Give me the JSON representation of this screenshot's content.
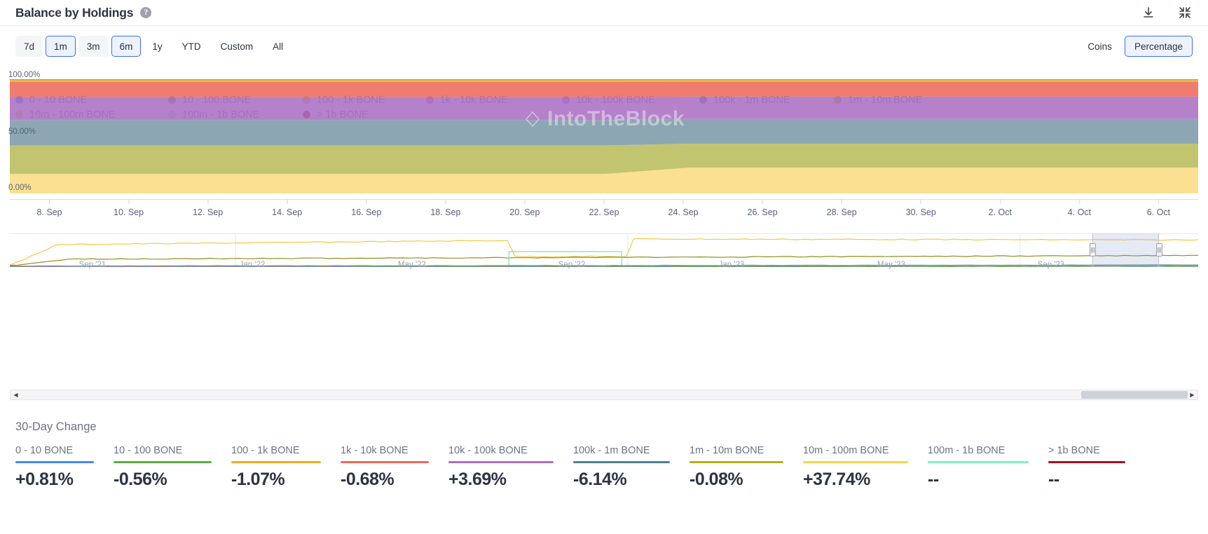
{
  "header": {
    "title": "Balance by Holdings",
    "help_icon": "question-mark-icon",
    "download_icon": "download-icon",
    "collapse_icon": "collapse-icon"
  },
  "toolbar": {
    "ranges": [
      {
        "label": "7d",
        "active": false
      },
      {
        "label": "1m",
        "active": true
      },
      {
        "label": "3m",
        "active": false
      },
      {
        "label": "6m",
        "active": true
      },
      {
        "label": "1y",
        "active": false
      },
      {
        "label": "YTD",
        "active": false
      },
      {
        "label": "Custom",
        "active": false
      },
      {
        "label": "All",
        "active": false
      }
    ],
    "modes": [
      {
        "label": "Coins",
        "active": false
      },
      {
        "label": "Percentage",
        "active": true
      }
    ]
  },
  "legend": [
    {
      "label": "0 - 10 BONE",
      "color": "#3d8ce8"
    },
    {
      "label": "10 - 100 BONE",
      "color": "#5aaf3f"
    },
    {
      "label": "100 - 1k BONE",
      "color": "#f0ab20"
    },
    {
      "label": "1k - 10k BONE",
      "color": "#ed6a5a"
    },
    {
      "label": "10k - 100k BONE",
      "color": "#ab6fc4"
    },
    {
      "label": "100k - 1m BONE",
      "color": "#4f7f8e"
    },
    {
      "label": "1m - 10m BONE",
      "color": "#b5ad17"
    },
    {
      "label": "10m - 100m BONE",
      "color": "#fbd34d"
    },
    {
      "label": "100m - 1b BONE",
      "color": "#84efc3"
    },
    {
      "label": "> 1b BONE",
      "color": "#9e1425"
    }
  ],
  "watermark": "IntoTheBlock",
  "chart_data": {
    "type": "area",
    "title": "Balance by Holdings",
    "stacked": true,
    "normalized_percent": true,
    "xlabel": "",
    "ylabel": "",
    "ylim": [
      0,
      100
    ],
    "ytick_labels": [
      "0.00%",
      "50.00%",
      "100.00%"
    ],
    "ytick_values": [
      0,
      50,
      100
    ],
    "xtick_labels": [
      "8. Sep",
      "10. Sep",
      "12. Sep",
      "14. Sep",
      "16. Sep",
      "18. Sep",
      "20. Sep",
      "22. Sep",
      "24. Sep",
      "26. Sep",
      "28. Sep",
      "30. Sep",
      "2. Oct",
      "4. Oct",
      "6. Oct"
    ],
    "grid": false,
    "legend_position": "top",
    "series": [
      {
        "name": "0 - 10 BONE",
        "color": "#3d8ce8",
        "values": [
          0.25,
          0.25,
          0.25,
          0.25,
          0.25,
          0.25,
          0.25,
          0.25,
          0.25,
          0.25,
          0.25,
          0.25,
          0.25,
          0.25,
          0.25
        ]
      },
      {
        "name": "10 - 100 BONE",
        "color": "#5aaf3f",
        "values": [
          0.45,
          0.45,
          0.45,
          0.45,
          0.45,
          0.45,
          0.45,
          0.45,
          0.45,
          0.45,
          0.45,
          0.45,
          0.45,
          0.45,
          0.45
        ]
      },
      {
        "name": "100 - 1k BONE",
        "color": "#f0ab20",
        "values": [
          1.6,
          1.6,
          1.6,
          1.6,
          1.6,
          1.6,
          1.6,
          1.6,
          1.55,
          1.55,
          1.55,
          1.55,
          1.55,
          1.55,
          1.55
        ]
      },
      {
        "name": "1k - 10k BONE",
        "color": "#ed6a5a",
        "values": [
          13.3,
          13.3,
          13.3,
          13.3,
          13.3,
          13.3,
          13.3,
          13.3,
          13.0,
          13.0,
          13.0,
          13.0,
          13.0,
          13.0,
          13.0
        ]
      },
      {
        "name": "10k - 100k BONE",
        "color": "#ab6fc4",
        "values": [
          20.2,
          20.2,
          20.2,
          20.2,
          20.2,
          20.2,
          20.2,
          20.2,
          19.6,
          19.6,
          19.6,
          19.6,
          19.6,
          19.6,
          19.6
        ]
      },
      {
        "name": "100k - 1m BONE",
        "color": "#7d9aa8",
        "values": [
          22.2,
          22.2,
          22.2,
          22.2,
          22.2,
          22.2,
          22.2,
          22.2,
          21.6,
          21.6,
          21.6,
          21.6,
          21.6,
          21.6,
          21.6
        ]
      },
      {
        "name": "1m - 10m BONE",
        "color": "#b9bd5c",
        "values": [
          25.0,
          25.0,
          25.0,
          25.0,
          25.0,
          25.0,
          25.0,
          25.0,
          21.0,
          21.0,
          21.0,
          21.0,
          21.0,
          21.0,
          21.0
        ]
      },
      {
        "name": "10m - 100m BONE",
        "color": "#fbdc82",
        "values": [
          17.0,
          17.0,
          17.0,
          17.0,
          17.0,
          17.0,
          17.0,
          17.0,
          22.55,
          22.55,
          22.55,
          22.55,
          22.55,
          22.55,
          22.55
        ]
      },
      {
        "name": "100m - 1b BONE",
        "color": "#84efc3",
        "values": [
          0,
          0,
          0,
          0,
          0,
          0,
          0,
          0,
          0,
          0,
          0,
          0,
          0,
          0,
          0
        ]
      },
      {
        "name": "> 1b BONE",
        "color": "#9e1425",
        "values": [
          0,
          0,
          0,
          0,
          0,
          0,
          0,
          0,
          0,
          0,
          0,
          0,
          0,
          0,
          0
        ]
      }
    ]
  },
  "navigator": {
    "labels": [
      "Sep '21",
      "Jan '22",
      "May '22",
      "Sep '22",
      "Jan '23",
      "May '23",
      "Sep '23"
    ],
    "left_arrow": "scroll-left-icon",
    "right_arrow": "scroll-right-icon"
  },
  "stats": {
    "title": "30-Day Change",
    "items": [
      {
        "label": "0 - 10 BONE",
        "value": "+0.81%",
        "color": "#3d8ce8"
      },
      {
        "label": "10 - 100 BONE",
        "value": "-0.56%",
        "color": "#5aaf3f"
      },
      {
        "label": "100 - 1k BONE",
        "value": "-1.07%",
        "color": "#f0ab20"
      },
      {
        "label": "1k - 10k BONE",
        "value": "-0.68%",
        "color": "#ed6a5a"
      },
      {
        "label": "10k - 100k BONE",
        "value": "+3.69%",
        "color": "#ab6fc4"
      },
      {
        "label": "100k - 1m BONE",
        "value": "-6.14%",
        "color": "#4f7f8e"
      },
      {
        "label": "1m - 10m BONE",
        "value": "-0.08%",
        "color": "#b5ad17"
      },
      {
        "label": "10m - 100m BONE",
        "value": "+37.74%",
        "color": "#fbd34d"
      },
      {
        "label": "100m - 1b BONE",
        "value": "--",
        "color": "#84efc3"
      },
      {
        "label": "> 1b BONE",
        "value": "--",
        "color": "#9e1425"
      }
    ]
  }
}
